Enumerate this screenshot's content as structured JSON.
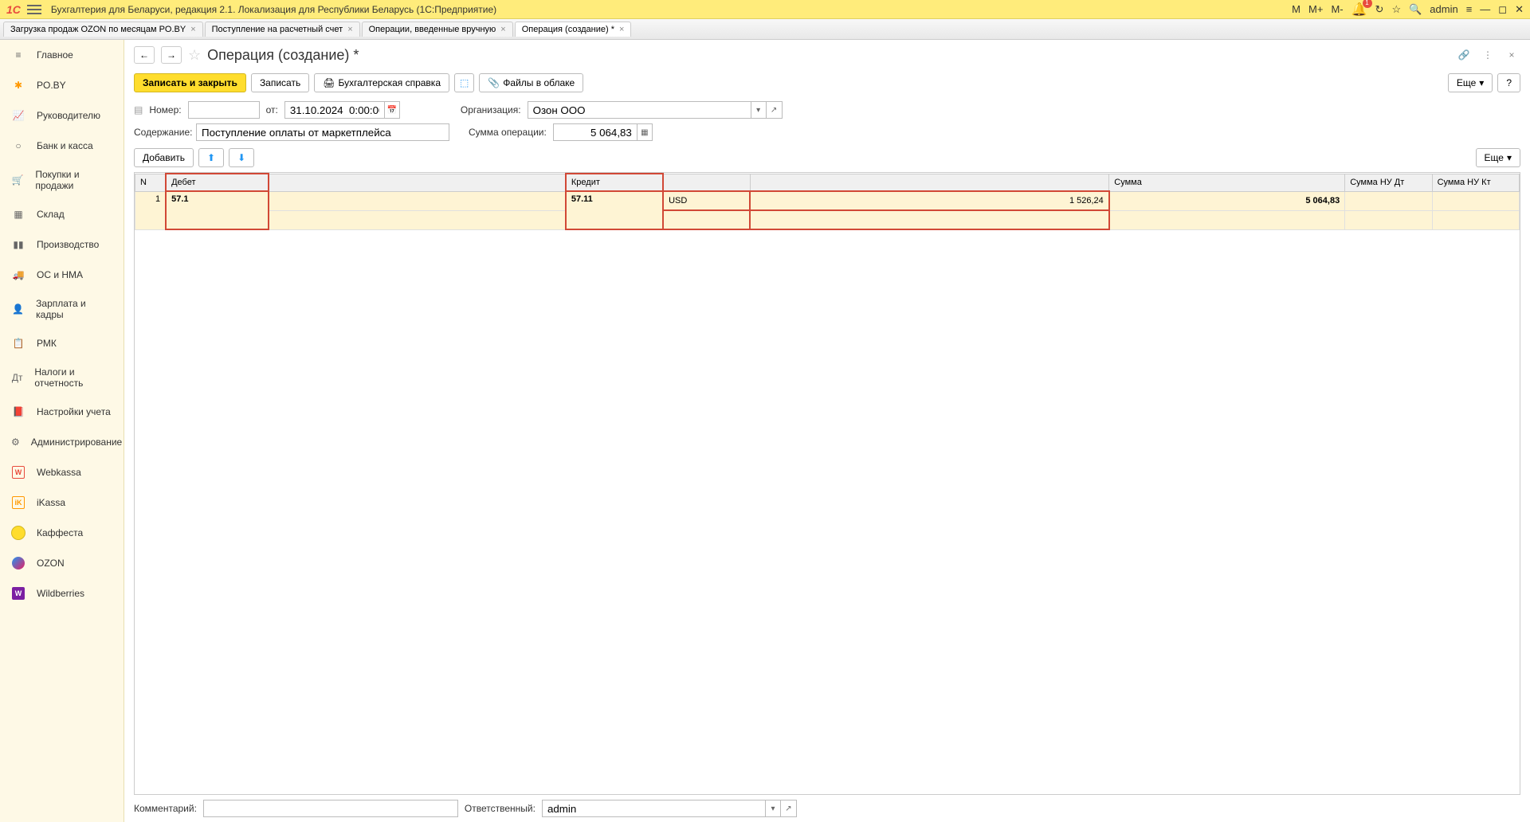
{
  "app": {
    "title": "Бухгалтерия для Беларуси, редакция 2.1. Локализация для Республики Беларусь   (1С:Предприятие)",
    "user": "admin",
    "notifications": "1",
    "m": "M",
    "m_plus": "M+",
    "m_minus": "M-"
  },
  "tabs": [
    {
      "label": "Загрузка продаж OZON по месяцам PO.BY",
      "active": false
    },
    {
      "label": "Поступление на расчетный счет",
      "active": false
    },
    {
      "label": "Операции, введенные вручную",
      "active": false
    },
    {
      "label": "Операция (создание) *",
      "active": true
    }
  ],
  "sidebar": {
    "items": [
      {
        "label": "Главное",
        "icon": "home"
      },
      {
        "label": "PO.BY",
        "icon": "poby"
      },
      {
        "label": "Руководителю",
        "icon": "chart"
      },
      {
        "label": "Банк и касса",
        "icon": "bank"
      },
      {
        "label": "Покупки и продажи",
        "icon": "cart"
      },
      {
        "label": "Склад",
        "icon": "warehouse"
      },
      {
        "label": "Производство",
        "icon": "production"
      },
      {
        "label": "ОС и НМА",
        "icon": "truck"
      },
      {
        "label": "Зарплата и кадры",
        "icon": "hr"
      },
      {
        "label": "РМК",
        "icon": "rmk"
      },
      {
        "label": "Налоги и отчетность",
        "icon": "tax"
      },
      {
        "label": "Настройки учета",
        "icon": "settings"
      },
      {
        "label": "Администрирование",
        "icon": "admin"
      },
      {
        "label": "Webkassa",
        "icon": "webkassa"
      },
      {
        "label": "iKassa",
        "icon": "ikassa"
      },
      {
        "label": "Каффеста",
        "icon": "kaffesta"
      },
      {
        "label": "OZON",
        "icon": "ozon"
      },
      {
        "label": "Wildberries",
        "icon": "wb"
      }
    ]
  },
  "page": {
    "title": "Операция (создание) *",
    "buttons": {
      "save_close": "Записать и закрыть",
      "save": "Записать",
      "acc_ref": "Бухгалтерская справка",
      "files": "Файлы в облаке",
      "more": "Еще",
      "add": "Добавить"
    },
    "form": {
      "number_label": "Номер:",
      "number_value": "",
      "date_label": "от:",
      "date_value": "31.10.2024  0:00:00",
      "org_label": "Организация:",
      "org_value": "Озон ООО",
      "content_label": "Содержание:",
      "content_value": "Поступление оплаты от маркетплейса",
      "sum_label": "Сумма операции:",
      "sum_value": "5 064,83"
    },
    "table": {
      "headers": {
        "n": "N",
        "debit": "Дебет",
        "credit": "Кредит",
        "sum": "Сумма",
        "nu_dt": "Сумма НУ Дт",
        "nu_kt": "Сумма НУ Кт"
      },
      "rows": [
        {
          "n": "1",
          "debit": "57.1",
          "credit": "57.11",
          "credit_cur": "USD",
          "credit_amt": "1 526,24",
          "sum": "5 064,83"
        }
      ]
    },
    "footer": {
      "comment_label": "Комментарий:",
      "comment_value": "",
      "responsible_label": "Ответственный:",
      "responsible_value": "admin"
    }
  }
}
